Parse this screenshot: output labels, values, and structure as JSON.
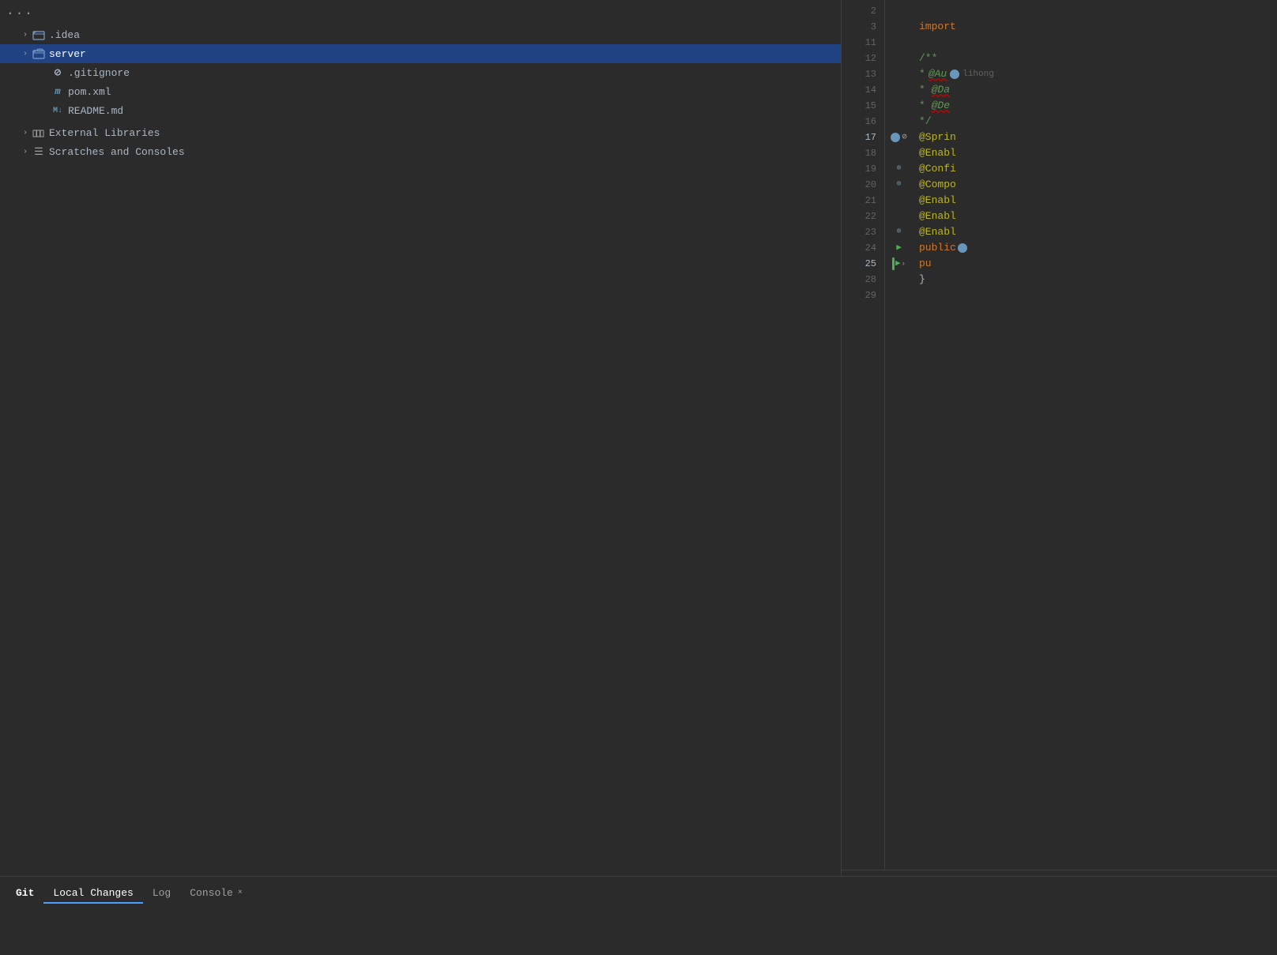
{
  "sidebar": {
    "three_dots": "···",
    "items": [
      {
        "id": "idea-folder",
        "label": ".idea",
        "type": "folder",
        "indent": 1,
        "expanded": false,
        "selected": false
      },
      {
        "id": "server-folder",
        "label": "server",
        "type": "folder",
        "indent": 1,
        "expanded": true,
        "selected": true
      },
      {
        "id": "gitignore-file",
        "label": ".gitignore",
        "type": "gitignore",
        "indent": 2,
        "selected": false
      },
      {
        "id": "pom-file",
        "label": "pom.xml",
        "type": "pom",
        "indent": 2,
        "selected": false
      },
      {
        "id": "readme-file",
        "label": "README.md",
        "type": "readme",
        "indent": 2,
        "selected": false
      },
      {
        "id": "external-libraries",
        "label": "External Libraries",
        "type": "libraries",
        "indent": 1,
        "expanded": false,
        "selected": false
      },
      {
        "id": "scratches",
        "label": "Scratches and Consoles",
        "type": "scratches",
        "indent": 1,
        "expanded": false,
        "selected": false
      }
    ]
  },
  "editor": {
    "lines": [
      {
        "num": 2,
        "content": "",
        "gutter": ""
      },
      {
        "num": 3,
        "content": "import",
        "gutter": ""
      },
      {
        "num": 11,
        "content": "",
        "gutter": ""
      },
      {
        "num": 12,
        "content": "/**",
        "gutter": ""
      },
      {
        "num": 13,
        "content": "* @Au",
        "gutter": ""
      },
      {
        "num": 14,
        "content": "* @Da",
        "gutter": ""
      },
      {
        "num": 15,
        "content": "* @De",
        "gutter": ""
      },
      {
        "num": 16,
        "content": "*/",
        "gutter": ""
      },
      {
        "num": 17,
        "content": "@Sprin",
        "gutter": "stop"
      },
      {
        "num": 18,
        "content": "@Enabl",
        "gutter": ""
      },
      {
        "num": 19,
        "content": "@Confi",
        "gutter": "search"
      },
      {
        "num": 20,
        "content": "@Compo",
        "gutter": "search"
      },
      {
        "num": 21,
        "content": "@Enabl",
        "gutter": ""
      },
      {
        "num": 22,
        "content": "@Enabl",
        "gutter": ""
      },
      {
        "num": 23,
        "content": "@Enabl",
        "gutter": "search"
      },
      {
        "num": 24,
        "content": "public",
        "gutter": "run"
      },
      {
        "num": 25,
        "content": "pu",
        "gutter": "run_active"
      },
      {
        "num": 28,
        "content": "}",
        "gutter": ""
      },
      {
        "num": 29,
        "content": "",
        "gutter": ""
      }
    ],
    "author_line": 17,
    "author_name": "lihong"
  },
  "bottom_bar": {
    "tabs": [
      {
        "id": "git",
        "label": "Git",
        "active": false,
        "closeable": false
      },
      {
        "id": "local-changes",
        "label": "Local Changes",
        "active": true,
        "closeable": false
      },
      {
        "id": "log",
        "label": "Log",
        "active": false,
        "closeable": false
      },
      {
        "id": "console",
        "label": "Console",
        "active": false,
        "closeable": true
      }
    ]
  },
  "icons": {
    "chevron_right": "›",
    "chevron_down": "⌄",
    "folder": "🗀",
    "gitignore": "⊘",
    "pom_m": "m",
    "readme_m": "M↓",
    "libraries": "🏛",
    "scratches": "☰",
    "close": "×"
  },
  "colors": {
    "background": "#2b2b2b",
    "selected_bg": "#214283",
    "active_tab_underline": "#4a9eff",
    "accent_blue": "#6897bb",
    "annotation_color": "#bbb529",
    "keyword_color": "#cc7832",
    "comment_color": "#629755",
    "run_green": "#4caf50"
  }
}
